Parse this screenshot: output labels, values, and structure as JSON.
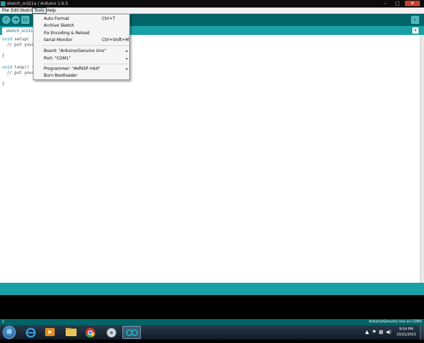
{
  "window": {
    "title": "sketch_oct21a | Arduino 1.6.5",
    "minimize": "–",
    "maximize": "□",
    "close": "✕"
  },
  "menubar": {
    "file": "File",
    "edit": "Edit",
    "sketch": "Sketch",
    "tools": "Tools",
    "help": "Help"
  },
  "toolbar": {
    "verify_glyph": "✓",
    "upload_glyph": "→",
    "new_glyph": "▭",
    "serial_glyph": "⌕"
  },
  "tab": {
    "name": "sketch_oct21a",
    "menu_glyph": "▾"
  },
  "code": {
    "l1a": "void",
    "l1b": " setup(",
    "l2": "  // put your",
    "l3": "}",
    "l4a": "void",
    "l4b": " loop() {",
    "l5": "  // put your",
    "l6": "}"
  },
  "tools_menu": {
    "auto_format": "Auto Format",
    "auto_format_sc": "Ctrl+T",
    "archive": "Archive Sketch",
    "fix_encoding": "Fix Encoding & Reload",
    "serial_monitor": "Serial Monitor",
    "serial_monitor_sc": "Ctrl+Shift+M",
    "board": "Board: \"Arduino/Genuino Uno\"",
    "port": "Port: \"COM1\"",
    "programmer": "Programmer: \"AVRISP mkII\"",
    "bootloader": "Burn Bootloader",
    "arrow": "▸"
  },
  "footer": {
    "line": "1",
    "board_port": "Arduino/Genuino Uno on COM1"
  },
  "taskbar": {
    "start_glyph": "⊞",
    "time": "9:54 PM",
    "date": "10/21/2015",
    "tray_up": "▲",
    "tray_flag": "⚑",
    "tray_net": "▦",
    "tray_vol": "◀)"
  },
  "colors": {
    "teal_dark": "#006468",
    "teal": "#17a1a5",
    "button": "#4db7bb"
  }
}
